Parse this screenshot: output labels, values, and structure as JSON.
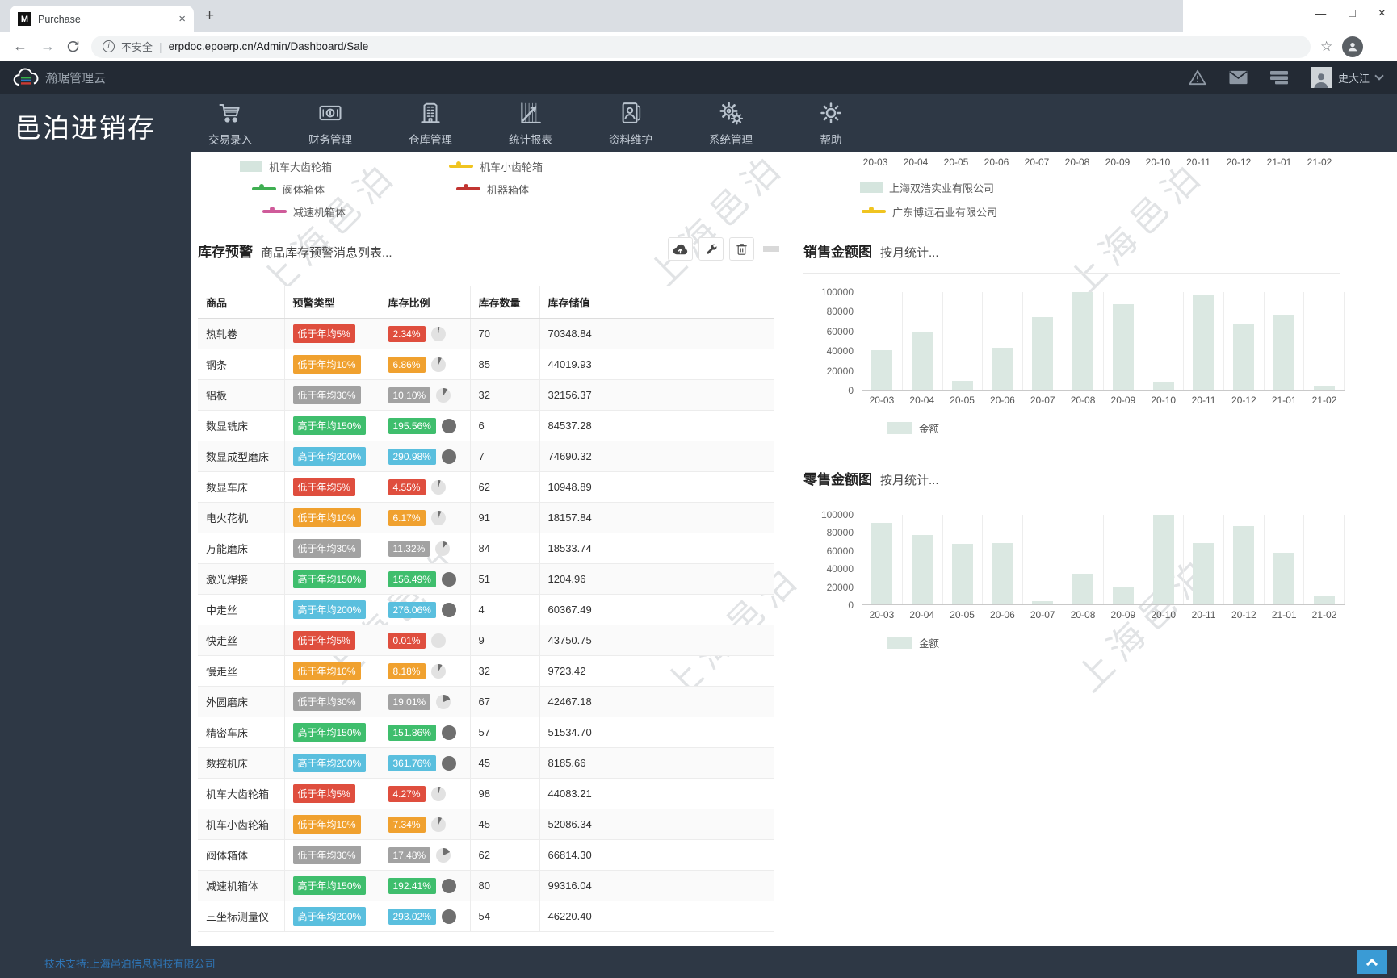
{
  "browser": {
    "tab_title": "Purchase",
    "favicon_letter": "M",
    "security_label": "不安全",
    "url": "erpdoc.epoerp.cn/Admin/Dashboard/Sale"
  },
  "topbar": {
    "brand": "瀚琚管理云",
    "user_name": "史大江"
  },
  "header": {
    "app_title": "邑泊进销存",
    "nav_items": [
      {
        "label": "交易录入",
        "icon": "cart-icon"
      },
      {
        "label": "财务管理",
        "icon": "money-icon"
      },
      {
        "label": "仓库管理",
        "icon": "warehouse-icon"
      },
      {
        "label": "统计报表",
        "icon": "report-icon"
      },
      {
        "label": "资料维护",
        "icon": "contacts-icon"
      },
      {
        "label": "系统管理",
        "icon": "gears-icon"
      },
      {
        "label": "帮助",
        "icon": "help-icon"
      }
    ]
  },
  "top_charts": {
    "left_legend": [
      {
        "label": "机车大齿轮箱",
        "type": "area",
        "color": "#d5e5de"
      },
      {
        "label": "机车小齿轮箱",
        "type": "line",
        "color": "#f0c420"
      },
      {
        "label": "阀体箱体",
        "type": "line",
        "color": "#3faf52"
      },
      {
        "label": "机器箱体",
        "type": "line",
        "color": "#c23531"
      },
      {
        "label": "减速机箱体",
        "type": "line",
        "color": "#cf5b9a"
      }
    ],
    "right_axis_labels": [
      "20-03",
      "20-04",
      "20-05",
      "20-06",
      "20-07",
      "20-08",
      "20-09",
      "20-10",
      "20-11",
      "20-12",
      "21-01",
      "21-02"
    ],
    "right_legend": [
      {
        "label": "上海双浩实业有限公司",
        "type": "area",
        "color": "#d5e5de"
      },
      {
        "label": "广东博远石业有限公司",
        "type": "line",
        "color": "#f0c420"
      }
    ]
  },
  "inventory_alert": {
    "title": "库存预警",
    "subtitle": "商品库存预警消息列表...",
    "toolbar_icons": [
      "cloud-upload-icon",
      "wrench-icon",
      "trash-icon"
    ],
    "columns": [
      "商品",
      "预警类型",
      "库存比例",
      "库存数量",
      "库存储值"
    ],
    "rows": [
      {
        "product": "热轧卷",
        "alert_type": "低于年均5%",
        "color": "red",
        "ratio": "2.34%",
        "qty": "70",
        "value": "70348.84"
      },
      {
        "product": "钢条",
        "alert_type": "低于年均10%",
        "color": "orange",
        "ratio": "6.86%",
        "qty": "85",
        "value": "44019.93"
      },
      {
        "product": "铝板",
        "alert_type": "低于年均30%",
        "color": "gray",
        "ratio": "10.10%",
        "qty": "32",
        "value": "32156.37"
      },
      {
        "product": "数显铣床",
        "alert_type": "高于年均150%",
        "color": "green",
        "ratio": "195.56%",
        "qty": "6",
        "value": "84537.28"
      },
      {
        "product": "数显成型磨床",
        "alert_type": "高于年均200%",
        "color": "blue",
        "ratio": "290.98%",
        "qty": "7",
        "value": "74690.32"
      },
      {
        "product": "数显车床",
        "alert_type": "低于年均5%",
        "color": "red",
        "ratio": "4.55%",
        "qty": "62",
        "value": "10948.89"
      },
      {
        "product": "电火花机",
        "alert_type": "低于年均10%",
        "color": "orange",
        "ratio": "6.17%",
        "qty": "91",
        "value": "18157.84"
      },
      {
        "product": "万能磨床",
        "alert_type": "低于年均30%",
        "color": "gray",
        "ratio": "11.32%",
        "qty": "84",
        "value": "18533.74"
      },
      {
        "product": "激光焊接",
        "alert_type": "高于年均150%",
        "color": "green",
        "ratio": "156.49%",
        "qty": "51",
        "value": "1204.96"
      },
      {
        "product": "中走丝",
        "alert_type": "高于年均200%",
        "color": "blue",
        "ratio": "276.06%",
        "qty": "4",
        "value": "60367.49"
      },
      {
        "product": "快走丝",
        "alert_type": "低于年均5%",
        "color": "red",
        "ratio": "0.01%",
        "qty": "9",
        "value": "43750.75"
      },
      {
        "product": "慢走丝",
        "alert_type": "低于年均10%",
        "color": "orange",
        "ratio": "8.18%",
        "qty": "32",
        "value": "9723.42"
      },
      {
        "product": "外圆磨床",
        "alert_type": "低于年均30%",
        "color": "gray",
        "ratio": "19.01%",
        "qty": "67",
        "value": "42467.18"
      },
      {
        "product": "精密车床",
        "alert_type": "高于年均150%",
        "color": "green",
        "ratio": "151.86%",
        "qty": "57",
        "value": "51534.70"
      },
      {
        "product": "数控机床",
        "alert_type": "高于年均200%",
        "color": "blue",
        "ratio": "361.76%",
        "qty": "45",
        "value": "8185.66"
      },
      {
        "product": "机车大齿轮箱",
        "alert_type": "低于年均5%",
        "color": "red",
        "ratio": "4.27%",
        "qty": "98",
        "value": "44083.21"
      },
      {
        "product": "机车小齿轮箱",
        "alert_type": "低于年均10%",
        "color": "orange",
        "ratio": "7.34%",
        "qty": "45",
        "value": "52086.34"
      },
      {
        "product": "阀体箱体",
        "alert_type": "低于年均30%",
        "color": "gray",
        "ratio": "17.48%",
        "qty": "62",
        "value": "66814.30"
      },
      {
        "product": "减速机箱体",
        "alert_type": "高于年均150%",
        "color": "green",
        "ratio": "192.41%",
        "qty": "80",
        "value": "99316.04"
      },
      {
        "product": "三坐标测量仪",
        "alert_type": "高于年均200%",
        "color": "blue",
        "ratio": "293.02%",
        "qty": "54",
        "value": "46220.40"
      }
    ]
  },
  "chart_data": [
    {
      "type": "bar",
      "title": "销售金额图",
      "subtitle": "按月统计...",
      "categories": [
        "20-03",
        "20-04",
        "20-05",
        "20-06",
        "20-07",
        "20-08",
        "20-09",
        "20-10",
        "20-11",
        "20-12",
        "21-01",
        "21-02"
      ],
      "series": [
        {
          "name": "金额",
          "values": [
            40000,
            58000,
            9000,
            43000,
            74000,
            99000,
            87000,
            8000,
            96000,
            67000,
            76000,
            4000
          ]
        }
      ],
      "ylim": [
        0,
        100000
      ],
      "yticks": [
        0,
        20000,
        40000,
        60000,
        80000,
        100000
      ],
      "bar_color": "#dbe8e2",
      "legend": [
        "金额"
      ],
      "legend_position": "bottom-left",
      "grid": "vertical"
    },
    {
      "type": "bar",
      "title": "零售金额图",
      "subtitle": "按月统计...",
      "categories": [
        "20-03",
        "20-04",
        "20-05",
        "20-06",
        "20-07",
        "20-08",
        "20-09",
        "20-10",
        "20-11",
        "20-12",
        "21-01",
        "21-02"
      ],
      "series": [
        {
          "name": "金额",
          "values": [
            90000,
            77000,
            67000,
            68000,
            3500,
            34000,
            20000,
            99000,
            68000,
            87000,
            57000,
            9000
          ]
        }
      ],
      "ylim": [
        0,
        100000
      ],
      "yticks": [
        0,
        20000,
        40000,
        60000,
        80000,
        100000
      ],
      "bar_color": "#dbe8e2",
      "legend": [
        "金额"
      ],
      "legend_position": "bottom-left",
      "grid": "vertical"
    }
  ],
  "theme": {
    "badge_colors": {
      "red": "#df4e3e",
      "orange": "#f0a12f",
      "gray": "#a2a2a2",
      "green": "#3fbe6d",
      "blue": "#5abfde"
    },
    "pie_dark": "#6f6f6f",
    "pie_light": "#e2e2e2",
    "bar_fill": "#dbe8e2",
    "navbar_bg": "#2e3845",
    "accent_blue": "#3a9bd5"
  },
  "watermark_text": "上海邑泊",
  "footer": {
    "text": "技术支持:上海邑泊信息科技有限公司"
  }
}
